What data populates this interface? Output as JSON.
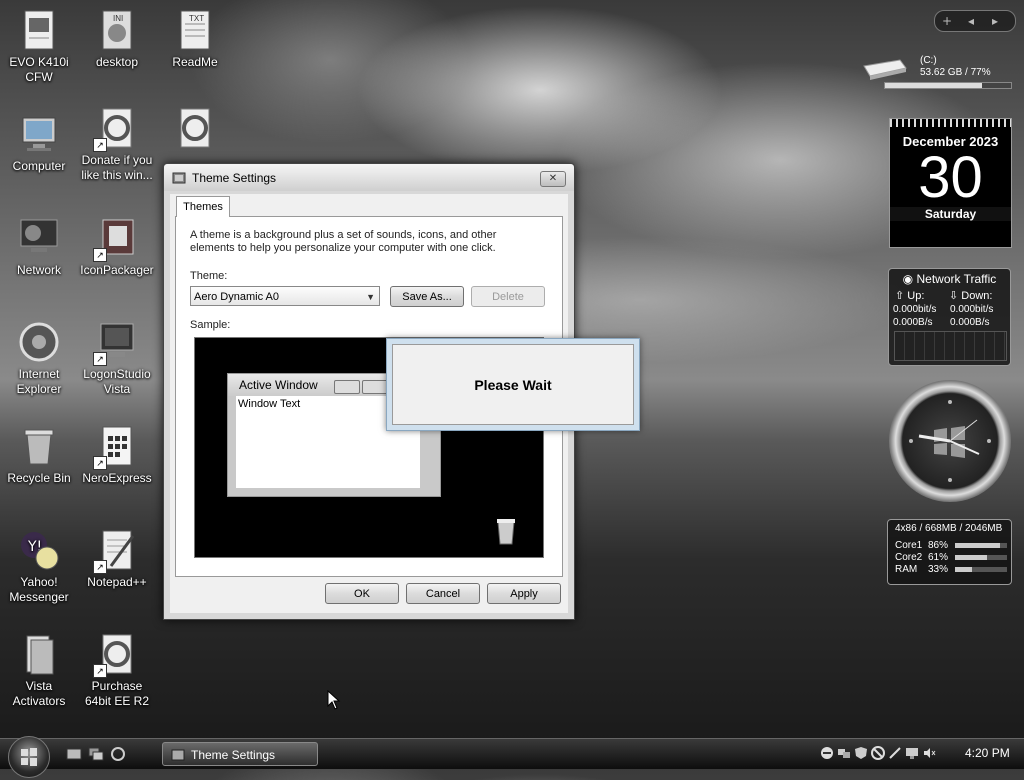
{
  "desktop_icons": [
    {
      "label": "EVO K410i CFW"
    },
    {
      "label": "desktop"
    },
    {
      "label": "ReadMe"
    },
    {
      "label": "Computer"
    },
    {
      "label": "Donate if you like this win..."
    },
    {
      "label": "Network"
    },
    {
      "label": "IconPackager"
    },
    {
      "label": "Internet Explorer"
    },
    {
      "label": "LogonStudio Vista"
    },
    {
      "label": "Recycle Bin"
    },
    {
      "label": "NeroExpress"
    },
    {
      "label": "Yahoo! Messenger"
    },
    {
      "label": "Notepad++"
    },
    {
      "label": "Vista Activators"
    },
    {
      "label": "Purchase 64bit EE R2"
    }
  ],
  "file_badges": {
    "ini": "INI",
    "txt": "TXT"
  },
  "dialog": {
    "title": "Theme Settings",
    "tab": "Themes",
    "description": "A theme is a background plus a set of sounds, icons, and other elements to help you personalize your computer with one click.",
    "theme_label": "Theme:",
    "theme_value": "Aero Dynamic A0",
    "save_as": "Save As...",
    "delete": "Delete",
    "sample_label": "Sample:",
    "active_window_title": "Active Window",
    "window_text": "Window Text",
    "ok": "OK",
    "cancel": "Cancel",
    "apply": "Apply"
  },
  "please_wait": "Please Wait",
  "gadgets": {
    "drive": {
      "label": "(C:)",
      "stats": "53.62 GB / 77%",
      "used_percent": 77
    },
    "calendar": {
      "month": "December 2023",
      "day": "30",
      "weekday": "Saturday"
    },
    "network": {
      "title": "Network Traffic",
      "up_label": "Up:",
      "down_label": "Down:",
      "up_bits": "0.000bit/s",
      "down_bits": "0.000bit/s",
      "up_bytes": "0.000B/s",
      "down_bytes": "0.000B/s"
    },
    "system": {
      "header": "4x86 / 668MB / 2046MB",
      "rows": [
        {
          "label": "Core1",
          "value": "86%",
          "pct": 86
        },
        {
          "label": "Core2",
          "value": "61%",
          "pct": 61
        },
        {
          "label": "RAM",
          "value": "33%",
          "pct": 33
        }
      ]
    }
  },
  "taskbar": {
    "task_button": "Theme Settings",
    "clock": "4:20 PM"
  },
  "colors": {
    "accent": "#cfe0ee",
    "desktop_dark": "#1b1b1b"
  }
}
